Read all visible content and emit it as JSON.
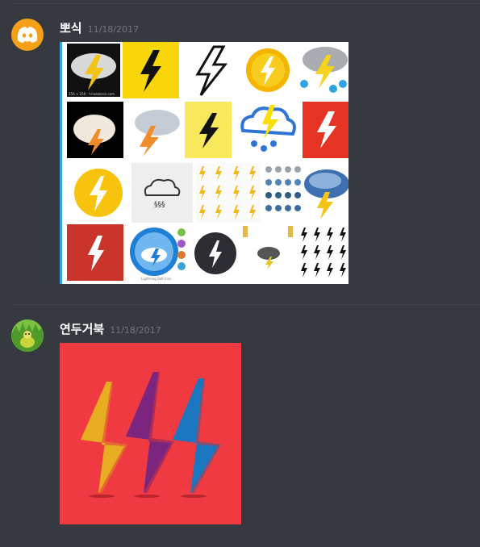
{
  "messages": [
    {
      "username": "뽀식",
      "timestamp": "11/18/2017",
      "avatar_icon": "discord-logo-icon",
      "avatar_color": "#f6a01a",
      "attachment": {
        "kind": "image-search-grid",
        "thumbnail_caption": "256 × 256 - hl-weatcon.com",
        "footer_caption": "Lightning Bolt Icon"
      }
    },
    {
      "username": "연두거북",
      "timestamp": "11/18/2017",
      "avatar_icon": "turtle-avatar-icon",
      "attachment": {
        "kind": "image",
        "background": "#ef3a42",
        "bolt_colors": [
          "#f6c12c",
          "#8c2a90",
          "#1e88d8"
        ]
      }
    }
  ]
}
